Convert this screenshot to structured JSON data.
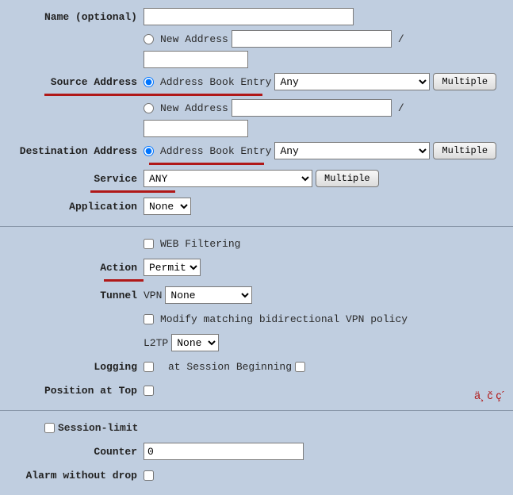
{
  "name": {
    "label": "Name (optional)",
    "value": ""
  },
  "source": {
    "label": "Source Address",
    "new_addr_label": "New Address",
    "addr_book_label": "Address Book Entry",
    "new_val1": "",
    "new_val2": "",
    "book_val": "Any",
    "multiple_btn": "Multiple",
    "slash": "/"
  },
  "dest": {
    "label": "Destination Address",
    "new_addr_label": "New Address",
    "addr_book_label": "Address Book Entry",
    "new_val1": "",
    "new_val2": "",
    "book_val": "Any",
    "multiple_btn": "Multiple",
    "slash": "/"
  },
  "service": {
    "label": "Service",
    "val": "ANY",
    "multiple_btn": "Multiple"
  },
  "application": {
    "label": "Application",
    "val": "None"
  },
  "webfilter": {
    "label": "WEB Filtering"
  },
  "action": {
    "label": "Action",
    "val": "Permit"
  },
  "tunnel": {
    "label": "Tunnel",
    "vpn_prefix": "VPN",
    "vpn_val": "None",
    "modify_label": "Modify matching bidirectional VPN policy",
    "l2tp_prefix": "L2TP",
    "l2tp_val": "None"
  },
  "logging": {
    "label": "Logging",
    "sess_begin": "at Session Beginning"
  },
  "position": {
    "label": "Position at Top"
  },
  "sessionlimit": {
    "label": "Session-limit"
  },
  "counter": {
    "label": "Counter",
    "val": "0"
  },
  "alarm": {
    "label": "Alarm without drop"
  },
  "watermark": "ä¸  č   ç´"
}
